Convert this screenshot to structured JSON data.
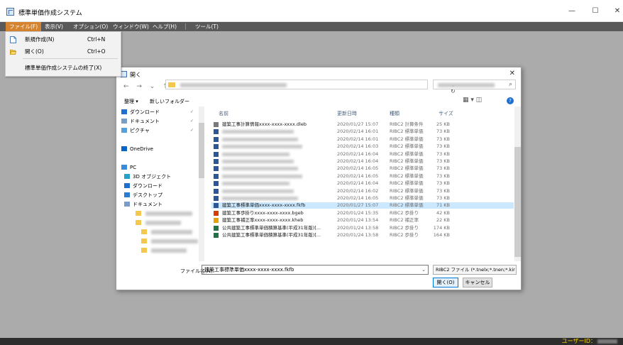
{
  "window": {
    "title": "標準単価作成システム",
    "minimize": "—",
    "maximize": "☐",
    "close": "✕"
  },
  "menubar": {
    "items": [
      {
        "label": "ファイル(F)",
        "active": true
      },
      {
        "label": "表示(V)",
        "active": false
      },
      {
        "label": "オプション(O)",
        "active": false
      },
      {
        "label": "ウィンドウ(W)",
        "active": false
      },
      {
        "label": "ヘルプ(H)",
        "active": false
      },
      {
        "label": "ツール(T)",
        "active": false
      }
    ]
  },
  "file_menu": {
    "new_label": "新規作成(N)",
    "new_shortcut": "Ctrl+N",
    "open_label": "開く(O)",
    "open_shortcut": "Ctrl+O",
    "exit_label": "標準単価作成システムの終了(X)"
  },
  "dialog": {
    "title": "開く",
    "close": "✕",
    "nav_arrows": "← → ⌄ ↑",
    "addr_controls": "⌄  ↻",
    "search_icon": "⌕",
    "organize": "整理 ▾",
    "new_folder": "新しいフォルダー",
    "view_icons": "▦ ▾  ◫",
    "help": "?",
    "nav_items": [
      {
        "label": "ダウンロード",
        "icon": "download-icon",
        "pinned": true,
        "blur": false
      },
      {
        "label": "ドキュメント",
        "icon": "document-icon",
        "pinned": true,
        "blur": false
      },
      {
        "label": "ピクチャ",
        "icon": "picture-icon",
        "pinned": true,
        "blur": false
      },
      {
        "label": "",
        "icon": "",
        "pinned": false,
        "blur": false
      },
      {
        "label": "OneDrive",
        "icon": "cloud-icon",
        "pinned": false,
        "blur": false
      },
      {
        "label": "",
        "icon": "",
        "pinned": false,
        "blur": false
      },
      {
        "label": "PC",
        "icon": "pc-icon",
        "pinned": false,
        "blur": false
      },
      {
        "label": "3D オブジェクト",
        "icon": "cube-icon",
        "pinned": false,
        "blur": false
      },
      {
        "label": "ダウンロード",
        "icon": "download-icon",
        "pinned": false,
        "blur": false
      },
      {
        "label": "デスクトップ",
        "icon": "desktop-icon",
        "pinned": false,
        "blur": false
      },
      {
        "label": "ドキュメント",
        "icon": "document-icon",
        "pinned": false,
        "blur": false
      },
      {
        "label": "",
        "icon": "folder-icon",
        "pinned": false,
        "blur": true
      },
      {
        "label": "",
        "icon": "folder-icon",
        "pinned": false,
        "blur": true
      },
      {
        "label": "",
        "icon": "folder-icon",
        "pinned": false,
        "blur": true
      },
      {
        "label": "",
        "icon": "folder-icon",
        "pinned": false,
        "blur": true
      },
      {
        "label": "",
        "icon": "folder-icon",
        "pinned": false,
        "blur": true
      }
    ],
    "columns": {
      "name": "名前",
      "date": "更新日時",
      "type": "種類",
      "size": "サイズ"
    },
    "files": [
      {
        "name": "建築工事計算情報xxxx-xxxx-xxxx.dleb",
        "date": "2020/01/27 15:07",
        "type": "RIBC2 計算条件",
        "size": "25 KB",
        "icon": "#7a7a7a",
        "selected": false,
        "blur": false
      },
      {
        "name": "",
        "date": "2020/02/14 16:01",
        "type": "RIBC2 標準単価",
        "size": "73 KB",
        "icon": "#2b579a",
        "selected": false,
        "blur": true
      },
      {
        "name": "",
        "date": "2020/02/14 16:01",
        "type": "RIBC2 標準単価",
        "size": "73 KB",
        "icon": "#2b579a",
        "selected": false,
        "blur": true
      },
      {
        "name": "",
        "date": "2020/02/14 16:03",
        "type": "RIBC2 標準単価",
        "size": "73 KB",
        "icon": "#2b579a",
        "selected": false,
        "blur": true
      },
      {
        "name": "",
        "date": "2020/02/14 16:04",
        "type": "RIBC2 標準単価",
        "size": "73 KB",
        "icon": "#2b579a",
        "selected": false,
        "blur": true
      },
      {
        "name": "",
        "date": "2020/02/14 16:04",
        "type": "RIBC2 標準単価",
        "size": "73 KB",
        "icon": "#2b579a",
        "selected": false,
        "blur": true
      },
      {
        "name": "",
        "date": "2020/02/14 16:05",
        "type": "RIBC2 標準単価",
        "size": "73 KB",
        "icon": "#2b579a",
        "selected": false,
        "blur": true
      },
      {
        "name": "",
        "date": "2020/02/14 16:05",
        "type": "RIBC2 標準単価",
        "size": "73 KB",
        "icon": "#2b579a",
        "selected": false,
        "blur": true
      },
      {
        "name": "",
        "date": "2020/02/14 16:04",
        "type": "RIBC2 標準単価",
        "size": "73 KB",
        "icon": "#2b579a",
        "selected": false,
        "blur": true
      },
      {
        "name": "",
        "date": "2020/02/14 16:02",
        "type": "RIBC2 標準単価",
        "size": "73 KB",
        "icon": "#2b579a",
        "selected": false,
        "blur": true
      },
      {
        "name": "",
        "date": "2020/02/14 16:05",
        "type": "RIBC2 標準単価",
        "size": "73 KB",
        "icon": "#2b579a",
        "selected": false,
        "blur": true
      },
      {
        "name": "建築工事標準単価xxxx-xxxx-xxxx.fkfb",
        "date": "2020/01/27 15:07",
        "type": "RIBC2 標準単価",
        "size": "71 KB",
        "icon": "#2b579a",
        "selected": true,
        "blur": false
      },
      {
        "name": "建築工事歩掛りxxxx-xxxx-xxxx.bgeb",
        "date": "2020/01/24 15:35",
        "type": "RIBC2 歩掛り",
        "size": "42 KB",
        "icon": "#d83b01",
        "selected": false,
        "blur": false
      },
      {
        "name": "建築工事補正率xxxx-xxxx-xxxx.kheb",
        "date": "2020/01/24 13:54",
        "type": "RIBC2 補正率",
        "size": "22 KB",
        "icon": "#e6a100",
        "selected": false,
        "blur": false
      },
      {
        "name": "公共建築工事標準単価積算基準(平成31年版)[...",
        "date": "2020/01/24 13:58",
        "type": "RIBC2 歩掛り",
        "size": "174 KB",
        "icon": "#217346",
        "selected": false,
        "blur": false
      },
      {
        "name": "公共建築工事標準単価積算基準(平成31年版)[...",
        "date": "2020/01/24 13:58",
        "type": "RIBC2 歩掛り",
        "size": "164 KB",
        "icon": "#217346",
        "selected": false,
        "blur": false
      }
    ],
    "filename_label": "ファイル名(N):",
    "filename_value": "建築工事標準単価xxxx-xxxx-xxxx.fkfb",
    "filetype": "RIBC2 ファイル (*.tnelx;*.tnen;*.kir",
    "open_button": "開く(O)",
    "cancel_button": "キャンセル"
  },
  "status": {
    "user_label": "ユーザーID："
  },
  "colors": {
    "menubar_bg": "#595959",
    "menu_active": "#d4842f",
    "workspace": "#ababab",
    "selection": "#cce8ff",
    "status_text": "#ffd700"
  }
}
